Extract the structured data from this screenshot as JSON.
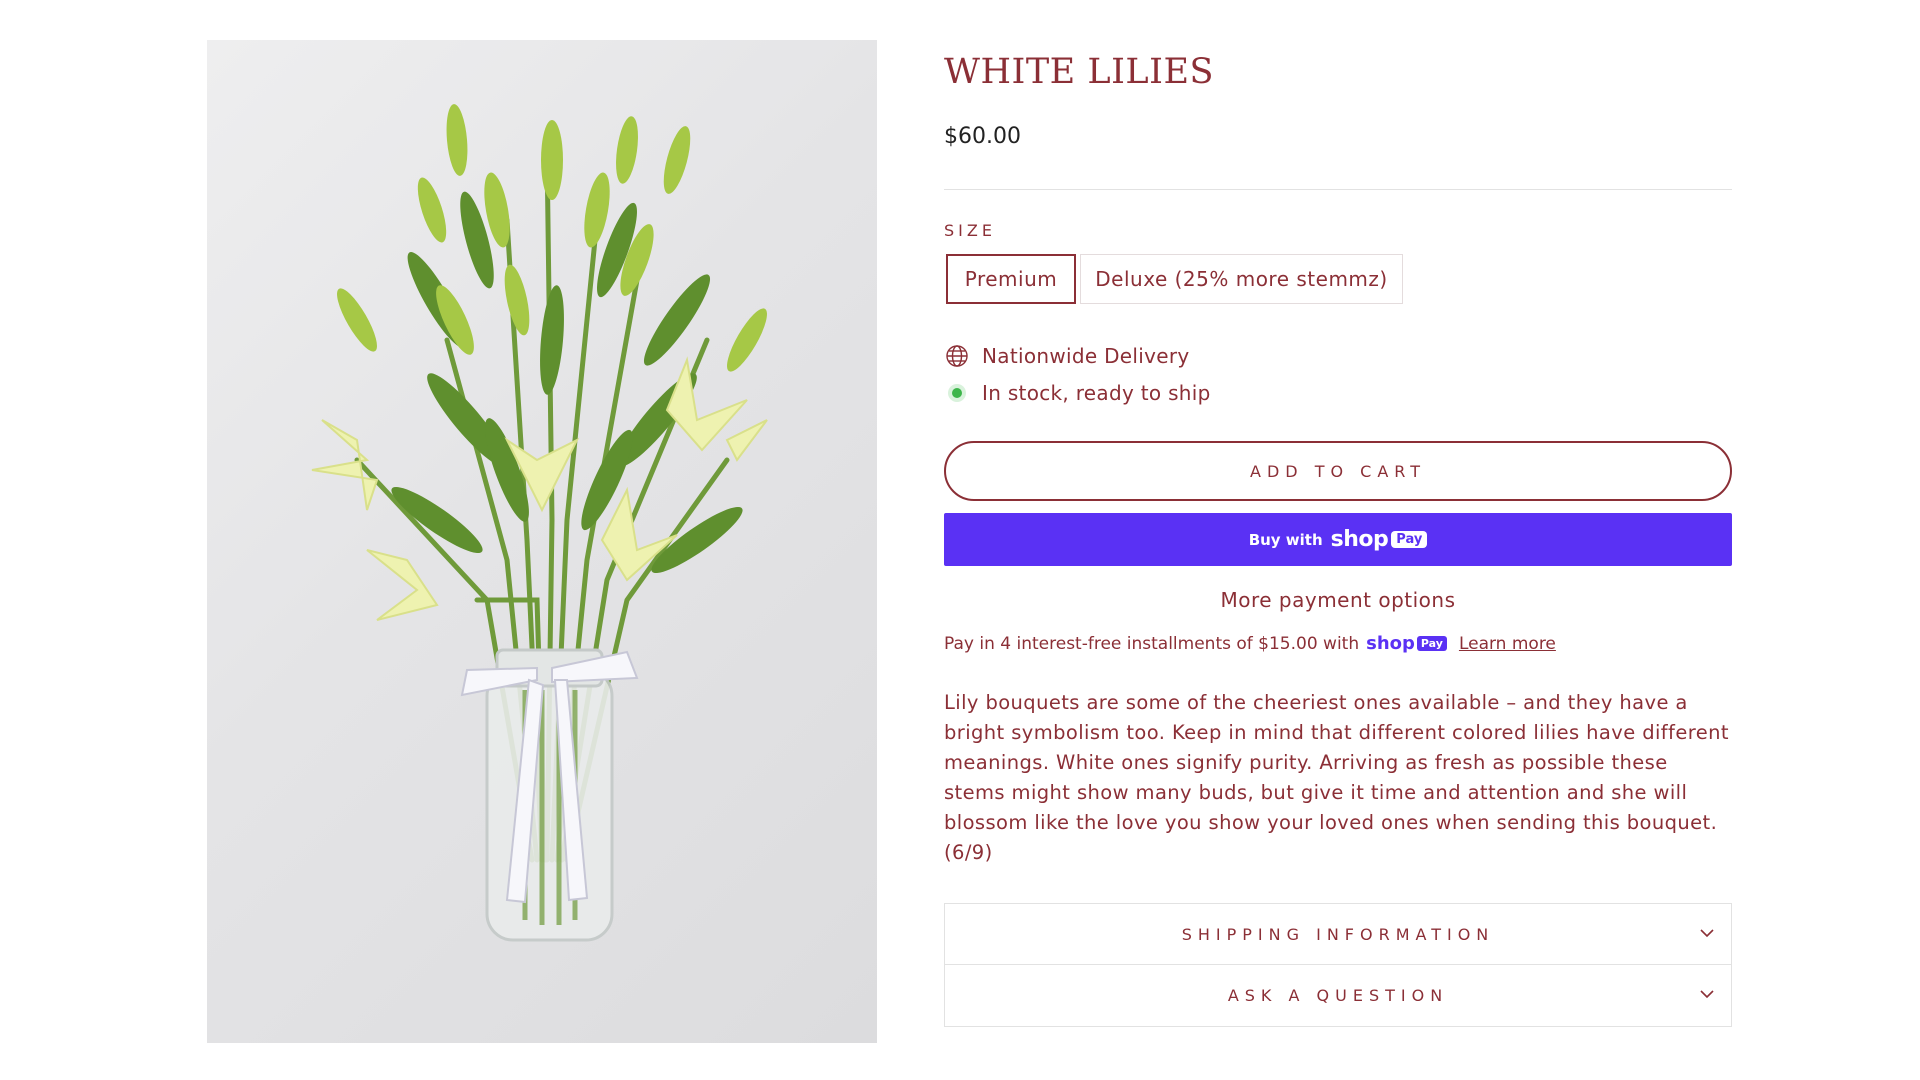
{
  "product": {
    "title": "WHITE LILIES",
    "price": "$60.00",
    "image_alt": "White lilies bouquet in a glass jar tied with a STEMMZ ribbon"
  },
  "size": {
    "label": "SIZE",
    "options": [
      {
        "label": "Premium",
        "selected": true
      },
      {
        "label": "Deluxe (25% more stemmz)",
        "selected": false
      }
    ]
  },
  "features": {
    "delivery": {
      "icon": "globe-icon",
      "text": "Nationwide Delivery"
    },
    "stock": {
      "icon": "in-stock-dot-icon",
      "text": "In stock, ready to ship",
      "color": "#3cb54a"
    }
  },
  "buttons": {
    "add_to_cart": "ADD TO CART",
    "buy_with": "Buy with",
    "shop_word": "shop",
    "pay_badge": "Pay",
    "more_payment": "More payment options"
  },
  "installments": {
    "text": "Pay in 4 interest-free installments of $15.00 with",
    "shop_word": "shop",
    "pay_badge": "Pay",
    "learn_more": "Learn more"
  },
  "description": "Lily bouquets are some of the cheeriest ones available – and they have a bright symbolism too. Keep in mind that different colored lilies have different meanings. White ones signify purity. Arriving as fresh as possible these stems might show many buds, but give it time and attention and she will blossom like the love you show your loved ones when sending this bouquet. (6/9)",
  "accordions": [
    {
      "label": "SHIPPING INFORMATION",
      "icon": "chevron-down-icon"
    },
    {
      "label": "ASK A QUESTION",
      "icon": "chevron-down-icon"
    }
  ],
  "colors": {
    "brand": "#8b2f36",
    "shop_pay": "#5a31f4",
    "stock_green": "#3cb54a"
  }
}
